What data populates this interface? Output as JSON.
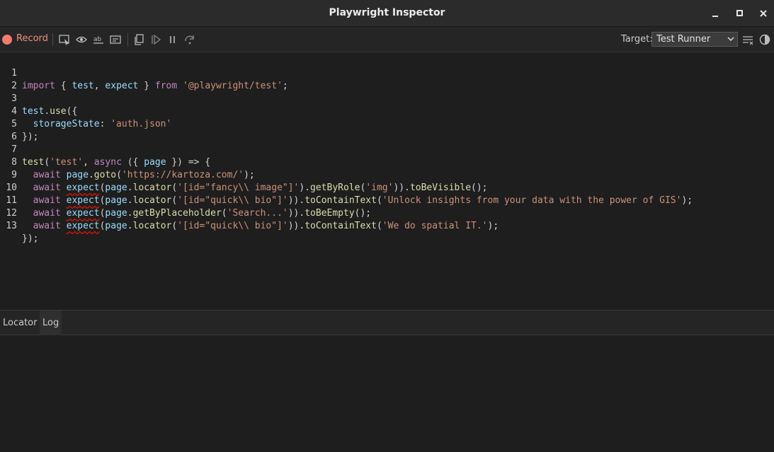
{
  "window": {
    "title": "Playwright Inspector"
  },
  "toolbar": {
    "record_label": "Record",
    "target_label": "Target:",
    "target_value": "Test Runner",
    "record_color": "#f27b6c",
    "icons": [
      "pick-locator-icon",
      "assert-visibility-icon",
      "assert-text-icon",
      "assert-value-icon",
      "copy-icon",
      "resume-icon",
      "pause-icon",
      "step-over-icon",
      "clear-icon",
      "theme-toggle-icon"
    ]
  },
  "editor": {
    "line_numbers": [
      "1",
      "2",
      "3",
      "4",
      "5",
      "6",
      "7",
      "8",
      "9",
      "10",
      "11",
      "12",
      "13"
    ],
    "tokens": {
      "l1": [
        "import",
        "{",
        "test",
        ",",
        "expect",
        "}",
        "from",
        "'@playwright/test'",
        ";"
      ],
      "l3": [
        "test",
        ".",
        "use",
        "({"
      ],
      "l4": [
        "storageState",
        ":",
        "'auth.json'"
      ],
      "l5": [
        "});"
      ],
      "l7": [
        "test",
        "(",
        "'test'",
        ",",
        "async",
        "({",
        "page",
        "}) => {"
      ],
      "l8": [
        "await",
        "page",
        ".",
        "goto",
        "(",
        "'https://kartoza.com/'",
        ");"
      ],
      "l9": [
        "await",
        "expect",
        "(",
        "page",
        ".",
        "locator",
        "(",
        "'[id=\"fancy\\\\ image\"]'",
        ").",
        "getByRole",
        "(",
        "'img'",
        ")).",
        "toBeVisible",
        "();"
      ],
      "l10": [
        "await",
        "expect",
        "(",
        "page",
        ".",
        "locator",
        "(",
        "'[id=\"quick\\\\ bio\"]'",
        ")).",
        "toContainText",
        "(",
        "'Unlock insights from your data with the power of GIS'",
        ");"
      ],
      "l11": [
        "await",
        "expect",
        "(",
        "page",
        ".",
        "getByPlaceholder",
        "(",
        "'Search...'",
        ")).",
        "toBeEmpty",
        "();"
      ],
      "l12": [
        "await",
        "expect",
        "(",
        "page",
        ".",
        "locator",
        "(",
        "'[id=\"quick\\\\ bio\"]'",
        ")).",
        "toContainText",
        "(",
        "'We do spatial IT.'",
        ");"
      ],
      "l13": [
        "});"
      ]
    }
  },
  "panel": {
    "tabs": [
      {
        "label": "Locator"
      },
      {
        "label": "Log"
      }
    ]
  }
}
